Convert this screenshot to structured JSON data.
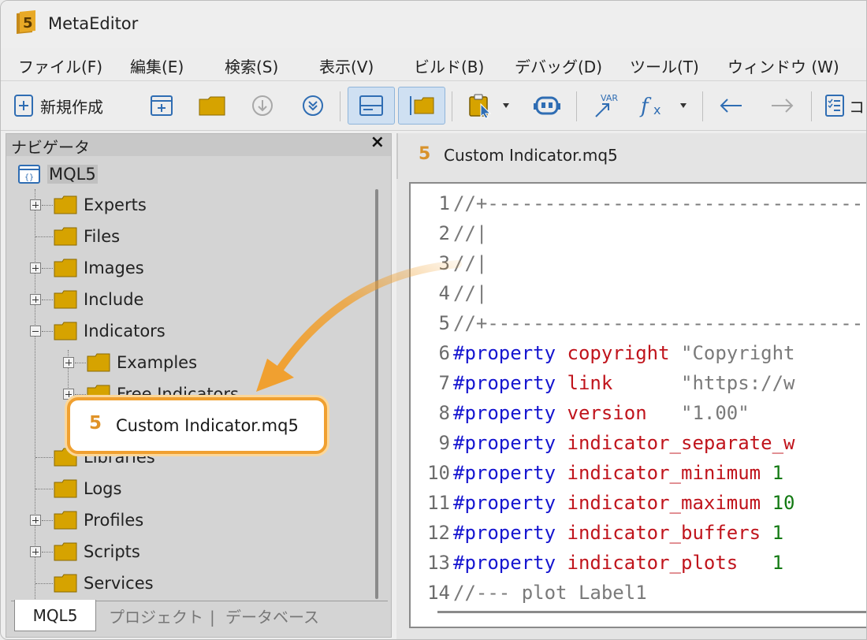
{
  "window": {
    "title": "MetaEditor"
  },
  "menu": [
    {
      "label": "ファイル(F)"
    },
    {
      "label": "編集(E)"
    },
    {
      "label": "検索(S)"
    },
    {
      "label": "表示(V)"
    },
    {
      "label": "ビルド(B)"
    },
    {
      "label": "デバッグ(D)"
    },
    {
      "label": "ツール(T)"
    },
    {
      "label": "ウィンドウ (W)"
    }
  ],
  "toolbar": {
    "new_label": "新規作成",
    "partial_label": "コ"
  },
  "navigator": {
    "title": "ナビゲータ",
    "close": "×",
    "root": "MQL5",
    "items": [
      {
        "label": "Experts"
      },
      {
        "label": "Files"
      },
      {
        "label": "Images"
      },
      {
        "label": "Include"
      },
      {
        "label": "Indicators"
      },
      {
        "label": "Examples"
      },
      {
        "label": "Free Indicators"
      },
      {
        "label": "Libraries"
      },
      {
        "label": "Logs"
      },
      {
        "label": "Profiles"
      },
      {
        "label": "Scripts"
      },
      {
        "label": "Services"
      }
    ],
    "tabs": {
      "active": "MQL5",
      "second": "プロジェクト",
      "sep": "|",
      "third": "データベース"
    }
  },
  "editor": {
    "tab_icon": "5",
    "tab_label": "Custom Indicator.mq5",
    "lines": [
      {
        "n": "1",
        "a": "//+----------------------------------",
        "b": "",
        "c": ""
      },
      {
        "n": "2",
        "a": "//|",
        "b": "",
        "c": ""
      },
      {
        "n": "3",
        "a": "//|",
        "b": "",
        "c": ""
      },
      {
        "n": "4",
        "a": "//|",
        "b": "",
        "c": ""
      },
      {
        "n": "5",
        "a": "//+----------------------------------",
        "b": "",
        "c": ""
      },
      {
        "n": "6",
        "a": "#property",
        "b": " copyright",
        "c": " \"Copyright"
      },
      {
        "n": "7",
        "a": "#property",
        "b": " link",
        "c": "      \"https://w"
      },
      {
        "n": "8",
        "a": "#property",
        "b": " version",
        "c": "   \"1.00\""
      },
      {
        "n": "9",
        "a": "#property",
        "b": " indicator_separate_w",
        "c": ""
      },
      {
        "n": "10",
        "a": "#property",
        "b": " indicator_minimum",
        "c": " 1"
      },
      {
        "n": "11",
        "a": "#property",
        "b": " indicator_maximum",
        "c": " 10"
      },
      {
        "n": "12",
        "a": "#property",
        "b": " indicator_buffers",
        "c": " 1"
      },
      {
        "n": "13",
        "a": "#property",
        "b": " indicator_plots",
        "c": "   1"
      },
      {
        "n": "14",
        "a": "//--- plot Label1",
        "b": "",
        "c": ""
      }
    ]
  },
  "drag_callout": {
    "icon": "5",
    "label": "Custom Indicator.mq5"
  },
  "colors": {
    "accent_orange": "#f0a030",
    "keyword_blue": "#1515d0",
    "property_red": "#c0141c",
    "number_green": "#137a13",
    "folder_gold": "#d6a300"
  }
}
